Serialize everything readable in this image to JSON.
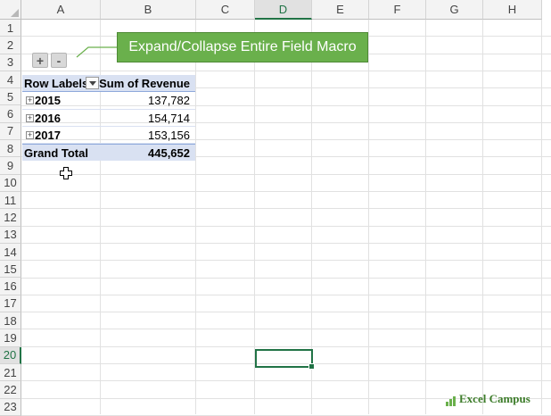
{
  "columns": [
    "A",
    "B",
    "C",
    "D",
    "E",
    "F",
    "G",
    "H"
  ],
  "rows": [
    "1",
    "2",
    "3",
    "4",
    "5",
    "6",
    "7",
    "8",
    "9",
    "10",
    "11",
    "12",
    "13",
    "14",
    "15",
    "16",
    "17",
    "18",
    "19",
    "20",
    "21",
    "22",
    "23"
  ],
  "selected_column": "D",
  "selected_row": "20",
  "macro_buttons": {
    "expand": "+",
    "collapse": "-"
  },
  "callout": {
    "text": "Expand/Collapse Entire Field Macro"
  },
  "pivot": {
    "header": {
      "row_labels": "Row Labels",
      "value_field": "Sum of Revenue"
    },
    "rows": [
      {
        "expander": "+",
        "label": "2015",
        "value": "137,782"
      },
      {
        "expander": "+",
        "label": "2016",
        "value": "154,714"
      },
      {
        "expander": "+",
        "label": "2017",
        "value": "153,156"
      }
    ],
    "total": {
      "label": "Grand Total",
      "value": "445,652"
    }
  },
  "logo": {
    "text": "Excel Campus"
  },
  "colors": {
    "accent": "#217346",
    "callout": "#6ab04c",
    "pivot_header": "#d9e1f2"
  }
}
